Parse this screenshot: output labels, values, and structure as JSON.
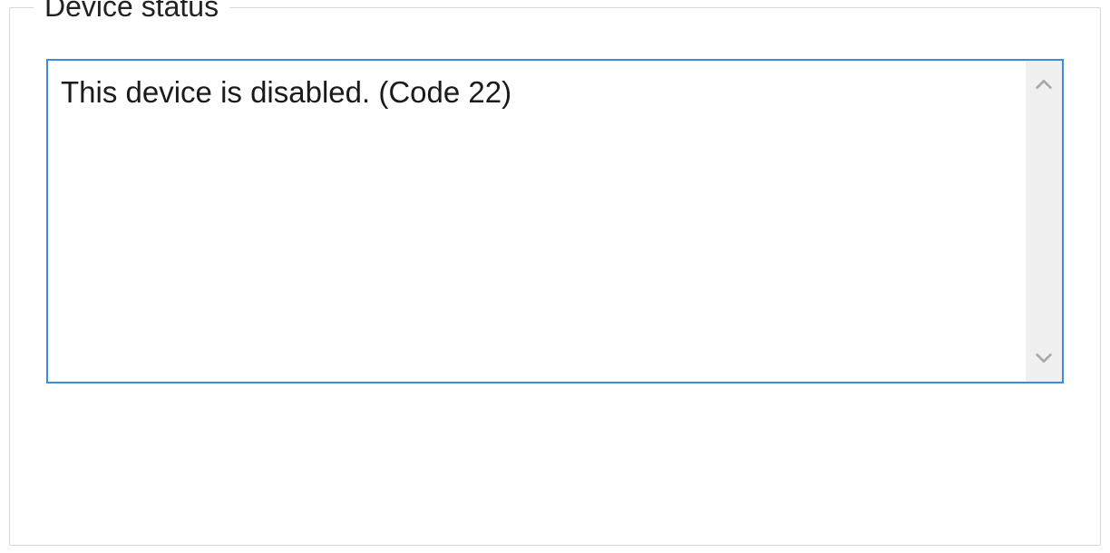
{
  "groupbox": {
    "legend": "Device status"
  },
  "status": {
    "message": "This device is disabled. (Code 22)"
  }
}
